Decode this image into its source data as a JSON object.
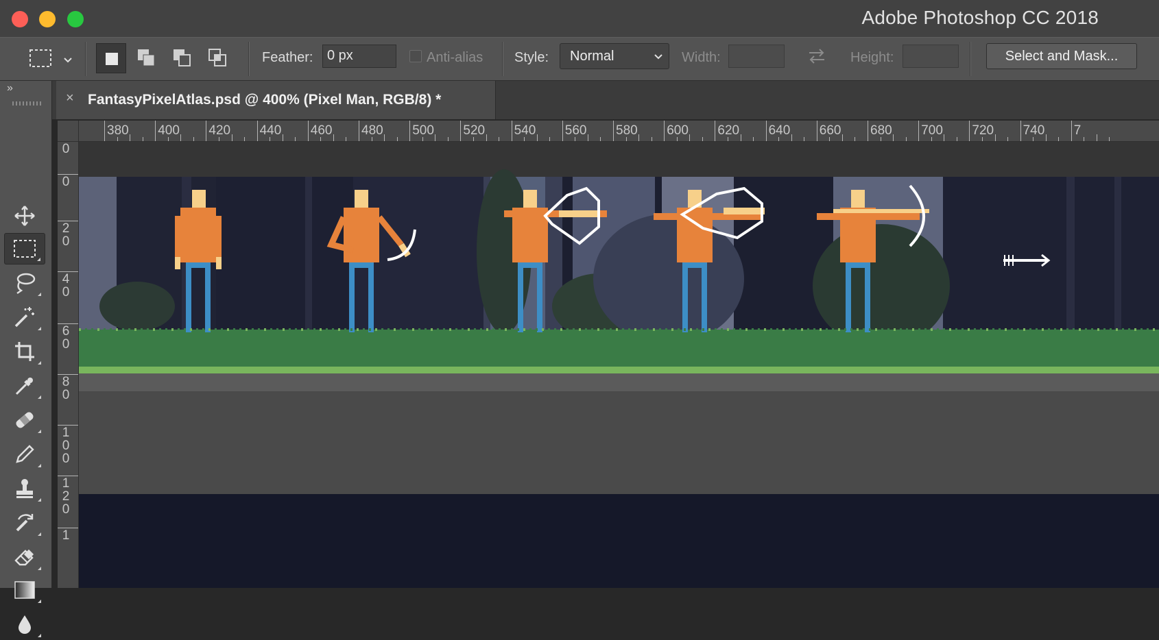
{
  "window": {
    "title": "Adobe Photoshop CC 2018",
    "traffic_lights": [
      "close",
      "minimize",
      "zoom"
    ]
  },
  "options_bar": {
    "tool_icon": "rectangular-marquee-icon",
    "selection_modes": [
      "new-selection-icon",
      "add-to-selection-icon",
      "subtract-from-selection-icon",
      "intersect-selection-icon"
    ],
    "feather_label": "Feather:",
    "feather_value": "0 px",
    "anti_alias_label": "Anti-alias",
    "style_label": "Style:",
    "style_value": "Normal",
    "width_label": "Width:",
    "height_label": "Height:",
    "swap_icon": "swap-arrows-icon",
    "select_mask_label": "Select and Mask..."
  },
  "toolbox": {
    "expand_glyph": "»",
    "tools": [
      {
        "name": "move-tool",
        "icon": "move-icon"
      },
      {
        "name": "rectangular-marquee-tool",
        "icon": "rectangular-marquee-icon",
        "active": true
      },
      {
        "name": "lasso-tool",
        "icon": "lasso-icon"
      },
      {
        "name": "magic-wand-tool",
        "icon": "magic-wand-icon"
      },
      {
        "name": "crop-tool",
        "icon": "crop-icon"
      },
      {
        "name": "eyedropper-tool",
        "icon": "eyedropper-icon"
      },
      {
        "name": "healing-brush-tool",
        "icon": "bandage-icon"
      },
      {
        "name": "brush-tool",
        "icon": "pencil-icon"
      },
      {
        "name": "clone-stamp-tool",
        "icon": "stamp-icon"
      },
      {
        "name": "history-brush-tool",
        "icon": "history-brush-icon"
      },
      {
        "name": "eraser-tool",
        "icon": "eraser-icon"
      },
      {
        "name": "gradient-tool",
        "icon": "gradient-icon"
      },
      {
        "name": "blur-tool",
        "icon": "drop-icon"
      }
    ]
  },
  "document": {
    "tab_close": "×",
    "tab_title": "FantasyPixelAtlas.psd @ 400% (Pixel Man, RGB/8) *"
  },
  "rulers": {
    "top_labels": [
      "380",
      "400",
      "420",
      "440",
      "460",
      "480",
      "500",
      "520",
      "540",
      "560",
      "580",
      "600",
      "620",
      "640",
      "660",
      "680",
      "700",
      "720",
      "740",
      "7"
    ],
    "left_labels": [
      "0",
      "0",
      "20",
      "40",
      "60",
      "80",
      "100",
      "120",
      "1"
    ]
  },
  "colors": {
    "sky": "#1b1d2e",
    "forest_dark": "#232536",
    "trunk": "#6a7087",
    "grass": "#3a7c46",
    "grass_light": "#79b65d",
    "dirt": "#4a4a4a",
    "dirt_top": "#5b5b5b",
    "skin": "#f7d08a",
    "shirt": "#e7833b",
    "pants": "#3d8ec6",
    "bow": "#ffffff"
  }
}
